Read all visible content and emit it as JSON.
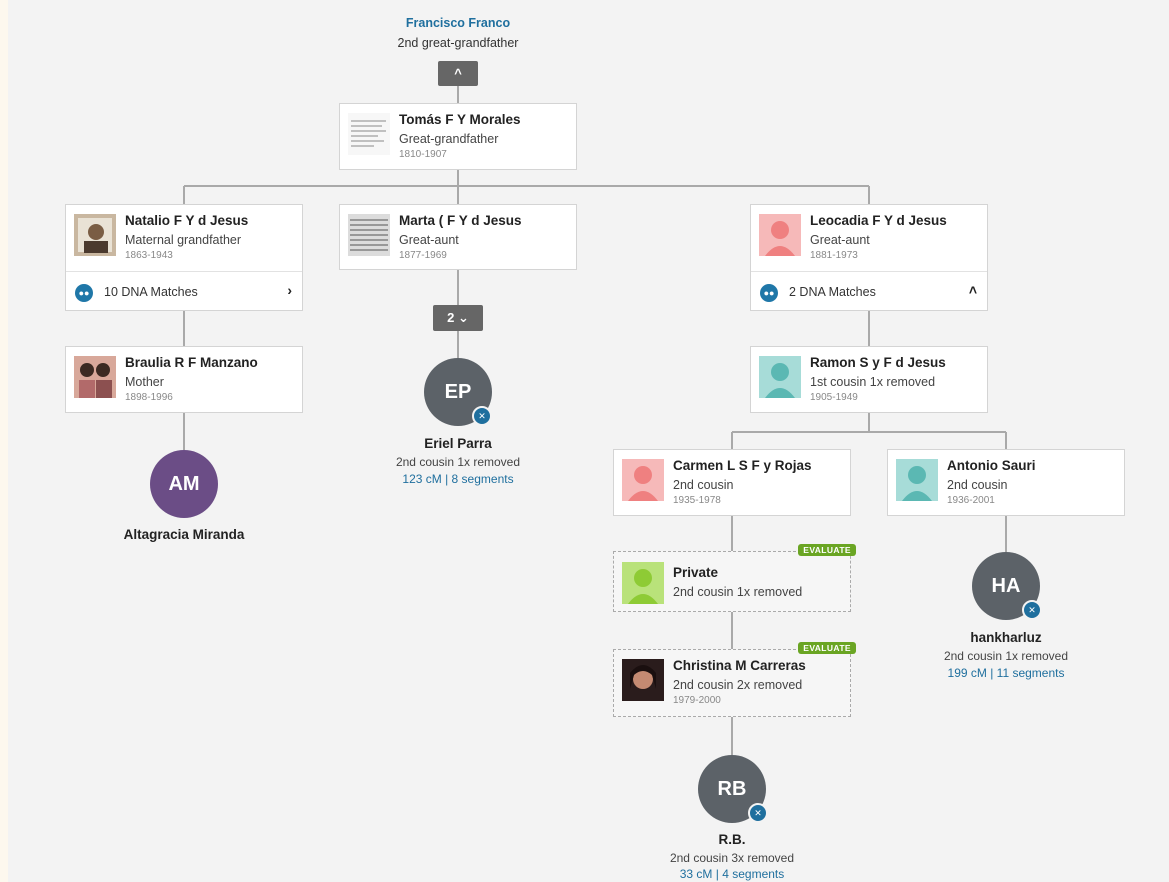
{
  "top_person": {
    "name": "Francisco Franco",
    "relation": "2nd great-grandfather"
  },
  "collapse_button": {
    "icon": "chevron-up-icon",
    "glyph": "^"
  },
  "cards": {
    "tomas": {
      "name": "Tomás F Y Morales",
      "relation": "Great-grandfather",
      "years": "1810-1907"
    },
    "natalio": {
      "name": "Natalio F Y d Jesus",
      "relation": "Maternal grandfather",
      "years": "1863-1943",
      "dna": "10 DNA Matches"
    },
    "marta": {
      "name": "Marta ( F Y d Jesus",
      "relation": "Great-aunt",
      "years": "1877-1969"
    },
    "leocadia": {
      "name": "Leocadia F Y d Jesus",
      "relation": "Great-aunt",
      "years": "1881-1973",
      "dna": "2 DNA Matches"
    },
    "braulia": {
      "name": "Braulia R F Manzano",
      "relation": "Mother",
      "years": "1898-1996"
    },
    "ramon": {
      "name": "Ramon S y F d Jesus",
      "relation": "1st cousin 1x removed",
      "years": "1905-1949"
    },
    "carmen": {
      "name": "Carmen L S F y Rojas",
      "relation": "2nd cousin",
      "years": "1935-1978"
    },
    "antonio": {
      "name": "Antonio Sauri",
      "relation": "2nd cousin",
      "years": "1936-2001"
    },
    "private": {
      "name": "Private",
      "relation": "2nd cousin 1x removed",
      "badge": "EVALUATE"
    },
    "christina": {
      "name": "Christina M Carreras",
      "relation": "2nd cousin 2x removed",
      "years": "1979-2000",
      "badge": "EVALUATE"
    }
  },
  "group_button": {
    "count": "2",
    "glyph": "⌄"
  },
  "matches": {
    "am": {
      "initials": "AM",
      "name": "Altagracia Miranda",
      "color": "#6b4d86"
    },
    "ep": {
      "initials": "EP",
      "name": "Eriel Parra",
      "relation": "2nd cousin 1x removed",
      "shared": "123 cM | 8 segments",
      "color": "#5c6268"
    },
    "ha": {
      "initials": "HA",
      "name": "hankharluz",
      "relation": "2nd cousin 1x removed",
      "shared": "199 cM | 11 segments",
      "color": "#5c6268"
    },
    "rb": {
      "initials": "RB",
      "name": "R.B.",
      "relation": "2nd cousin 3x removed",
      "shared": "33 cM | 4 segments",
      "color": "#5c6268"
    }
  },
  "colors": {
    "link": "#1f6f9e",
    "evaluate": "#6aa523",
    "female_silhouette": "#ef8080",
    "male_silhouette": "#5bb8b3",
    "private_silhouette": "#8ecb35"
  }
}
